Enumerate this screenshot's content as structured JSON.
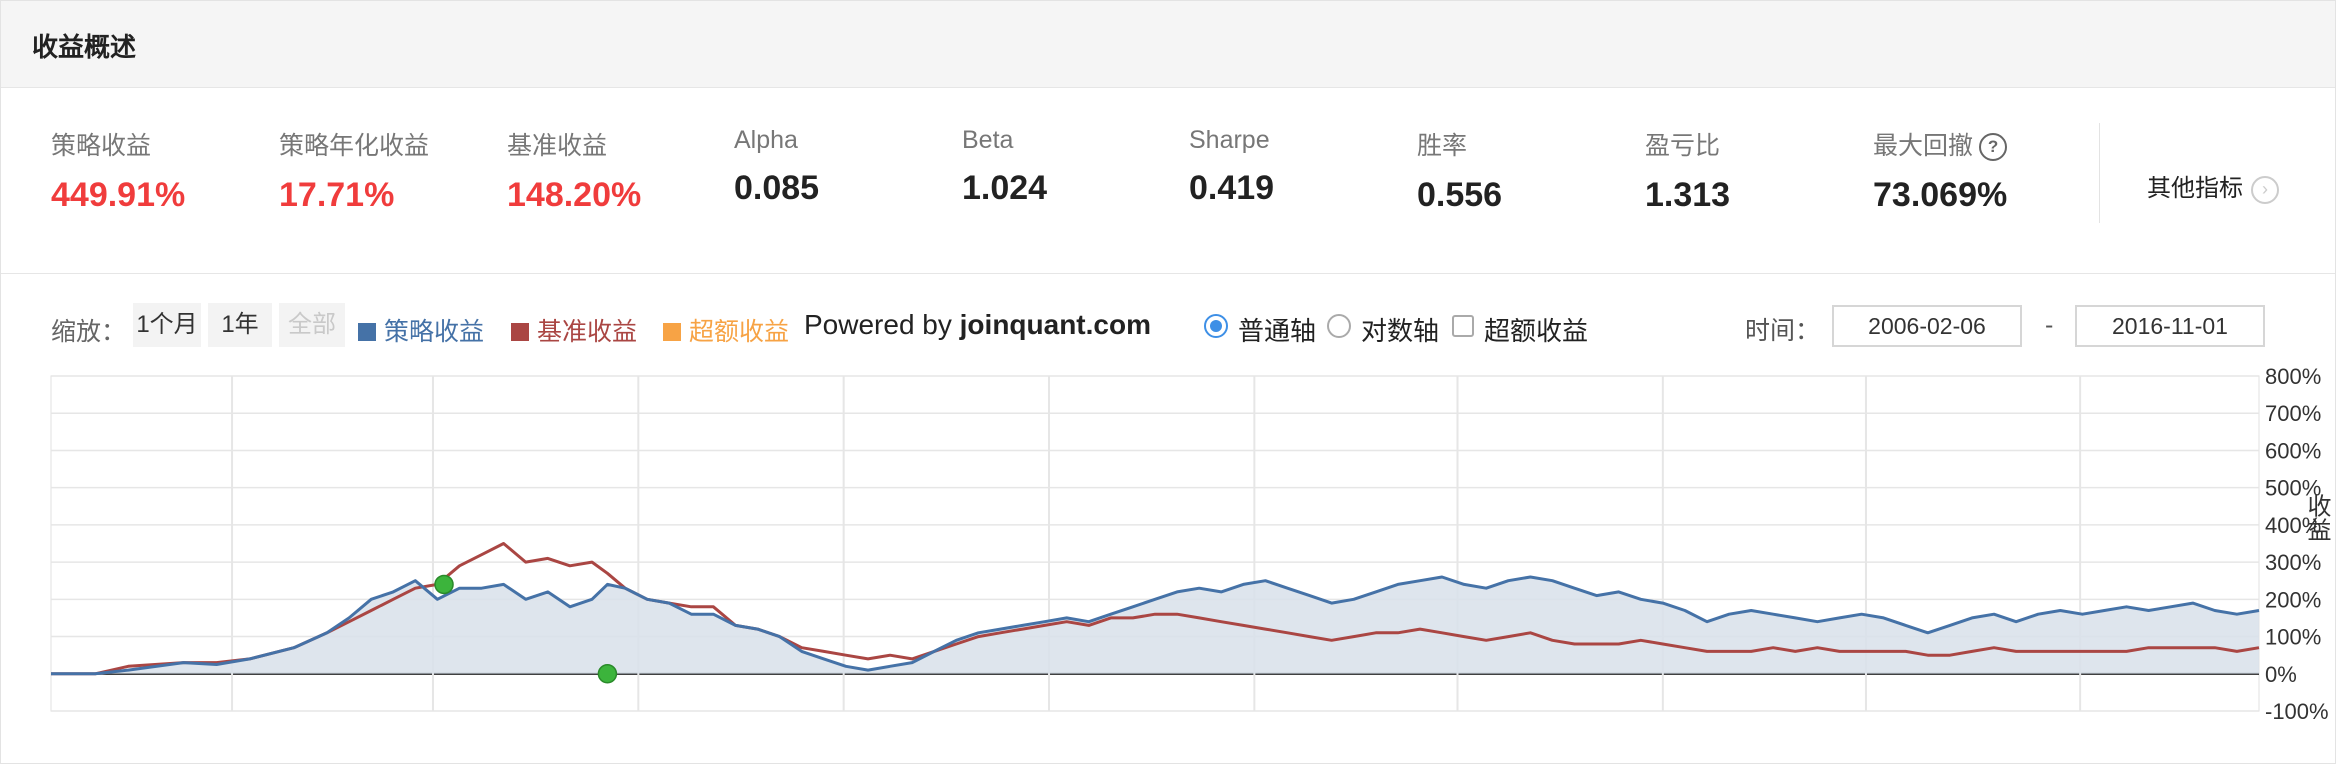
{
  "header": {
    "title": "收益概述"
  },
  "metrics": [
    {
      "label": "策略收益",
      "value": "449.91%",
      "color": "red"
    },
    {
      "label": "策略年化收益",
      "value": "17.71%",
      "color": "red"
    },
    {
      "label": "基准收益",
      "value": "148.20%",
      "color": "red"
    },
    {
      "label": "Alpha",
      "value": "0.085",
      "color": "dark"
    },
    {
      "label": "Beta",
      "value": "1.024",
      "color": "dark"
    },
    {
      "label": "Sharpe",
      "value": "0.419",
      "color": "dark"
    },
    {
      "label": "胜率",
      "value": "0.556",
      "color": "dark"
    },
    {
      "label": "盈亏比",
      "value": "1.313",
      "color": "dark"
    },
    {
      "label": "最大回撤",
      "value": "73.069%",
      "color": "dark",
      "icon": "help-icon",
      "icon_glyph": "?"
    }
  ],
  "more_metrics": {
    "label": "其他指标",
    "icon": "chevron-right-icon",
    "glyph": "›"
  },
  "toolbar": {
    "zoom_label": "缩放：",
    "zoom_options": [
      "1个月",
      "1年",
      "全部"
    ],
    "zoom_disabled": "全部",
    "legend": [
      {
        "label": "策略收益",
        "color": "#4572a7"
      },
      {
        "label": "基准收益",
        "color": "#aa4643"
      },
      {
        "label": "超额收益",
        "color": "#f7a345"
      }
    ],
    "powered_prefix": "Powered by",
    "powered_site": "joinquant.com",
    "axis_options": [
      {
        "label": "普通轴",
        "selected": true
      },
      {
        "label": "对数轴",
        "selected": false
      }
    ],
    "excess_checkbox": {
      "label": "超额收益",
      "checked": false
    },
    "time_label": "时间：",
    "date_from": "2006-02-06",
    "date_to": "2016-11-01",
    "date_separator": "-"
  },
  "chart_data": {
    "type": "area",
    "ylabel": "收益",
    "ylim": [
      -100,
      800
    ],
    "y_tick_labels": [
      "800%",
      "700%",
      "600%",
      "500%",
      "400%",
      "300%",
      "200%",
      "100%",
      "0%",
      "-100%"
    ],
    "x_range": [
      "2006-02-06",
      "2016-11-01"
    ],
    "grid": true,
    "colors": {
      "strategy": "#4572a7",
      "benchmark": "#aa4643",
      "fill": "#d8e0ea",
      "marker": "#3cb43c"
    },
    "series": [
      {
        "name": "策略收益",
        "points": [
          [
            0.0,
            0
          ],
          [
            0.02,
            0
          ],
          [
            0.035,
            10
          ],
          [
            0.06,
            30
          ],
          [
            0.075,
            25
          ],
          [
            0.09,
            40
          ],
          [
            0.11,
            70
          ],
          [
            0.125,
            110
          ],
          [
            0.135,
            150
          ],
          [
            0.145,
            200
          ],
          [
            0.155,
            220
          ],
          [
            0.165,
            250
          ],
          [
            0.175,
            200
          ],
          [
            0.185,
            230
          ],
          [
            0.195,
            230
          ],
          [
            0.205,
            240
          ],
          [
            0.215,
            200
          ],
          [
            0.225,
            220
          ],
          [
            0.235,
            180
          ],
          [
            0.245,
            200
          ],
          [
            0.252,
            240
          ],
          [
            0.26,
            230
          ],
          [
            0.27,
            200
          ],
          [
            0.28,
            190
          ],
          [
            0.29,
            160
          ],
          [
            0.3,
            160
          ],
          [
            0.31,
            130
          ],
          [
            0.32,
            120
          ],
          [
            0.33,
            100
          ],
          [
            0.34,
            60
          ],
          [
            0.35,
            40
          ],
          [
            0.36,
            20
          ],
          [
            0.37,
            10
          ],
          [
            0.38,
            20
          ],
          [
            0.39,
            30
          ],
          [
            0.4,
            60
          ],
          [
            0.41,
            90
          ],
          [
            0.42,
            110
          ],
          [
            0.43,
            120
          ],
          [
            0.44,
            130
          ],
          [
            0.45,
            140
          ],
          [
            0.46,
            150
          ],
          [
            0.47,
            140
          ],
          [
            0.48,
            160
          ],
          [
            0.49,
            180
          ],
          [
            0.5,
            200
          ],
          [
            0.51,
            220
          ],
          [
            0.52,
            230
          ],
          [
            0.53,
            220
          ],
          [
            0.54,
            240
          ],
          [
            0.55,
            250
          ],
          [
            0.56,
            230
          ],
          [
            0.57,
            210
          ],
          [
            0.58,
            190
          ],
          [
            0.59,
            200
          ],
          [
            0.6,
            220
          ],
          [
            0.61,
            240
          ],
          [
            0.62,
            250
          ],
          [
            0.63,
            260
          ],
          [
            0.64,
            240
          ],
          [
            0.65,
            230
          ],
          [
            0.66,
            250
          ],
          [
            0.67,
            260
          ],
          [
            0.68,
            250
          ],
          [
            0.69,
            230
          ],
          [
            0.7,
            210
          ],
          [
            0.71,
            220
          ],
          [
            0.72,
            200
          ],
          [
            0.73,
            190
          ],
          [
            0.74,
            170
          ],
          [
            0.75,
            140
          ],
          [
            0.76,
            160
          ],
          [
            0.77,
            170
          ],
          [
            0.78,
            160
          ],
          [
            0.79,
            150
          ],
          [
            0.8,
            140
          ],
          [
            0.81,
            150
          ],
          [
            0.82,
            160
          ],
          [
            0.83,
            150
          ],
          [
            0.84,
            130
          ],
          [
            0.85,
            110
          ],
          [
            0.86,
            130
          ],
          [
            0.87,
            150
          ],
          [
            0.88,
            160
          ],
          [
            0.89,
            140
          ],
          [
            0.9,
            160
          ],
          [
            0.91,
            170
          ],
          [
            0.92,
            160
          ],
          [
            0.93,
            170
          ],
          [
            0.94,
            180
          ],
          [
            0.95,
            170
          ],
          [
            0.96,
            180
          ],
          [
            0.97,
            190
          ],
          [
            0.98,
            170
          ],
          [
            0.99,
            160
          ],
          [
            1.0,
            170
          ]
        ]
      },
      {
        "name": "基准收益",
        "points": [
          [
            0.0,
            0
          ],
          [
            0.02,
            0
          ],
          [
            0.035,
            20
          ],
          [
            0.06,
            30
          ],
          [
            0.075,
            30
          ],
          [
            0.09,
            40
          ],
          [
            0.11,
            70
          ],
          [
            0.125,
            110
          ],
          [
            0.135,
            140
          ],
          [
            0.145,
            170
          ],
          [
            0.155,
            200
          ],
          [
            0.165,
            230
          ],
          [
            0.175,
            240
          ],
          [
            0.185,
            290
          ],
          [
            0.195,
            320
          ],
          [
            0.205,
            350
          ],
          [
            0.215,
            300
          ],
          [
            0.225,
            310
          ],
          [
            0.235,
            290
          ],
          [
            0.245,
            300
          ],
          [
            0.252,
            270
          ],
          [
            0.26,
            230
          ],
          [
            0.27,
            200
          ],
          [
            0.28,
            190
          ],
          [
            0.29,
            180
          ],
          [
            0.3,
            180
          ],
          [
            0.31,
            130
          ],
          [
            0.32,
            120
          ],
          [
            0.33,
            100
          ],
          [
            0.34,
            70
          ],
          [
            0.35,
            60
          ],
          [
            0.36,
            50
          ],
          [
            0.37,
            40
          ],
          [
            0.38,
            50
          ],
          [
            0.39,
            40
          ],
          [
            0.4,
            60
          ],
          [
            0.41,
            80
          ],
          [
            0.42,
            100
          ],
          [
            0.43,
            110
          ],
          [
            0.44,
            120
          ],
          [
            0.45,
            130
          ],
          [
            0.46,
            140
          ],
          [
            0.47,
            130
          ],
          [
            0.48,
            150
          ],
          [
            0.49,
            150
          ],
          [
            0.5,
            160
          ],
          [
            0.51,
            160
          ],
          [
            0.52,
            150
          ],
          [
            0.53,
            140
          ],
          [
            0.54,
            130
          ],
          [
            0.55,
            120
          ],
          [
            0.56,
            110
          ],
          [
            0.57,
            100
          ],
          [
            0.58,
            90
          ],
          [
            0.59,
            100
          ],
          [
            0.6,
            110
          ],
          [
            0.61,
            110
          ],
          [
            0.62,
            120
          ],
          [
            0.63,
            110
          ],
          [
            0.64,
            100
          ],
          [
            0.65,
            90
          ],
          [
            0.66,
            100
          ],
          [
            0.67,
            110
          ],
          [
            0.68,
            90
          ],
          [
            0.69,
            80
          ],
          [
            0.7,
            80
          ],
          [
            0.71,
            80
          ],
          [
            0.72,
            90
          ],
          [
            0.73,
            80
          ],
          [
            0.74,
            70
          ],
          [
            0.75,
            60
          ],
          [
            0.76,
            60
          ],
          [
            0.77,
            60
          ],
          [
            0.78,
            70
          ],
          [
            0.79,
            60
          ],
          [
            0.8,
            70
          ],
          [
            0.81,
            60
          ],
          [
            0.82,
            60
          ],
          [
            0.83,
            60
          ],
          [
            0.84,
            60
          ],
          [
            0.85,
            50
          ],
          [
            0.86,
            50
          ],
          [
            0.87,
            60
          ],
          [
            0.88,
            70
          ],
          [
            0.89,
            60
          ],
          [
            0.9,
            60
          ],
          [
            0.91,
            60
          ],
          [
            0.92,
            60
          ],
          [
            0.93,
            60
          ],
          [
            0.94,
            60
          ],
          [
            0.95,
            70
          ],
          [
            0.96,
            70
          ],
          [
            0.97,
            70
          ],
          [
            0.98,
            70
          ],
          [
            0.99,
            60
          ],
          [
            1.0,
            70
          ]
        ]
      }
    ],
    "markers": [
      {
        "x": 0.178,
        "y": 240,
        "name": "max-drawdown-start-marker"
      },
      {
        "x": 0.252,
        "y": 0,
        "name": "max-drawdown-end-marker"
      }
    ]
  }
}
